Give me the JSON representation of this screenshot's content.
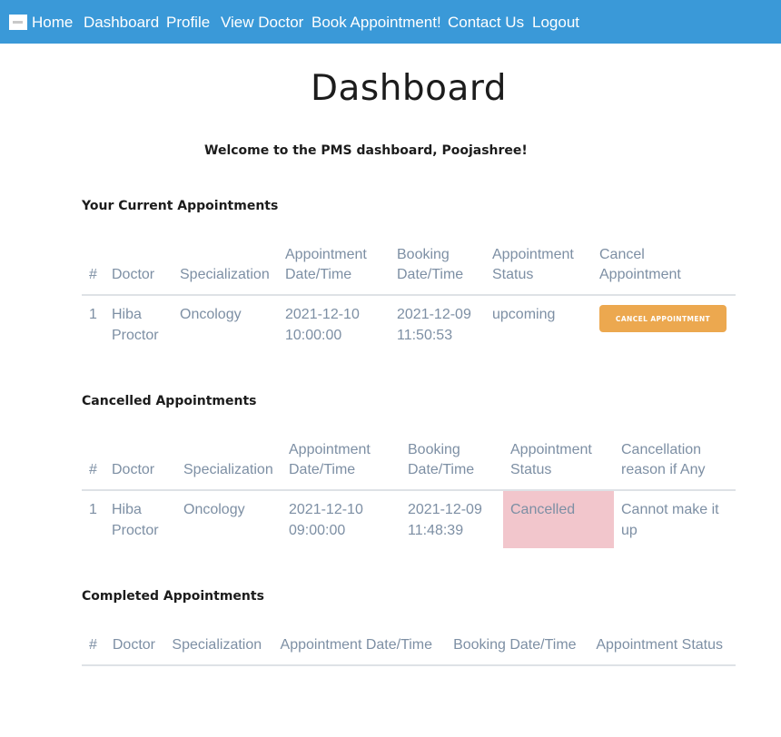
{
  "nav": {
    "items": [
      "Home",
      "Dashboard",
      "Profile",
      "View Doctor",
      "Book Appointment!",
      "Contact Us",
      "Logout"
    ]
  },
  "page": {
    "title": "Dashboard",
    "welcome": "Welcome to the PMS dashboard, Poojashree!"
  },
  "current": {
    "title": "Your Current Appointments",
    "headers": [
      "#",
      "Doctor",
      "Specialization",
      "Appointment Date/Time",
      "Booking Date/Time",
      "Appointment Status",
      "Cancel Appointment"
    ],
    "rows": [
      {
        "num": "1",
        "doctor": "Hiba Proctor",
        "spec": "Oncology",
        "appt": "2021-12-10 10:00:00",
        "booking": "2021-12-09 11:50:53",
        "status": "upcoming",
        "action": "CANCEL APPOINTMENT"
      }
    ]
  },
  "cancelled": {
    "title": "Cancelled Appointments",
    "headers": [
      "#",
      "Doctor",
      "Specialization",
      "Appointment Date/Time",
      "Booking Date/Time",
      "Appointment Status",
      "Cancellation reason if Any"
    ],
    "rows": [
      {
        "num": "1",
        "doctor": "Hiba Proctor",
        "spec": "Oncology",
        "appt": "2021-12-10 09:00:00",
        "booking": "2021-12-09 11:48:39",
        "status": "Cancelled",
        "reason": "Cannot make it up"
      }
    ]
  },
  "completed": {
    "title": "Completed Appointments",
    "headers": [
      "#",
      "Doctor",
      "Specialization",
      "Appointment Date/Time",
      "Booking Date/Time",
      "Appointment Status"
    ]
  },
  "colors": {
    "navbar": "#3a99d8",
    "cancel_button": "#eca84f",
    "cancelled_highlight": "#f2c6cc",
    "table_text": "#7d8fa4"
  }
}
